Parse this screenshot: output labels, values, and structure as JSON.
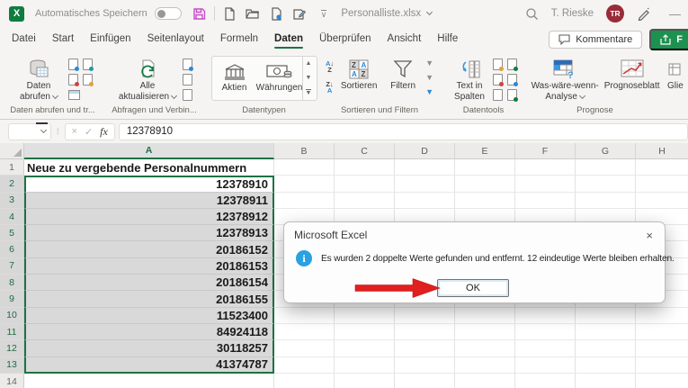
{
  "titlebar": {
    "app": "Excel",
    "logo_letter": "X",
    "autosave_label": "Automatisches Speichern",
    "filename": "Personalliste.xlsx",
    "user_name": "T. Rieske",
    "user_initials": "TR",
    "minimize_glyph": "—"
  },
  "menu": {
    "tabs": [
      "Datei",
      "Start",
      "Einfügen",
      "Seitenlayout",
      "Formeln",
      "Daten",
      "Überprüfen",
      "Ansicht",
      "Hilfe"
    ],
    "active_tab": "Daten",
    "comments_label": "Kommentare",
    "share_label": "F"
  },
  "ribbon": {
    "groups": {
      "get_data": {
        "label": "Daten abrufen und tr...",
        "button_line1": "Daten",
        "button_line2": "abrufen"
      },
      "queries": {
        "label": "Abfragen und Verbin...",
        "button_line1": "Alle",
        "button_line2": "aktualisieren"
      },
      "data_types": {
        "label": "Datentypen",
        "item1": "Aktien",
        "item2": "Währungen"
      },
      "sort_filter": {
        "label": "Sortieren und Filtern",
        "sort_label": "Sortieren",
        "filter_label": "Filtern",
        "az": "AZ↓",
        "za": "ZA↓"
      },
      "data_tools": {
        "label": "Datentools",
        "button_line1": "Text in",
        "button_line2": "Spalten"
      },
      "forecast": {
        "label": "Prognose",
        "whatif_line1": "Was-wäre-wenn-",
        "whatif_line2": "Analyse",
        "sheet_label": "Prognoseblatt"
      },
      "outline": {
        "label": "Glie"
      }
    }
  },
  "formula_bar": {
    "value": "12378910",
    "fx_label": "fx",
    "cancel_glyph": "×",
    "enter_glyph": "✓"
  },
  "sheet": {
    "columns": [
      "A",
      "B",
      "C",
      "D",
      "E",
      "F",
      "G",
      "H"
    ],
    "rows": [
      {
        "n": 1,
        "v": "Neue zu vergebende Personalnummern"
      },
      {
        "n": 2,
        "v": "12378910"
      },
      {
        "n": 3,
        "v": "12378911"
      },
      {
        "n": 4,
        "v": "12378912"
      },
      {
        "n": 5,
        "v": "12378913"
      },
      {
        "n": 6,
        "v": "20186152"
      },
      {
        "n": 7,
        "v": "20186153"
      },
      {
        "n": 8,
        "v": "20186154"
      },
      {
        "n": 9,
        "v": "20186155"
      },
      {
        "n": 10,
        "v": "11523400"
      },
      {
        "n": 11,
        "v": "84924118"
      },
      {
        "n": 12,
        "v": "30118257"
      },
      {
        "n": 13,
        "v": "41374787"
      },
      {
        "n": 14,
        "v": ""
      }
    ]
  },
  "dialog": {
    "title": "Microsoft Excel",
    "message": "Es wurden 2 doppelte Werte gefunden und entfernt. 12 eindeutige Werte bleiben erhalten.",
    "ok_label": "OK",
    "close_glyph": "×"
  },
  "colors": {
    "excel_green": "#107c41",
    "selection_green": "#1e7145",
    "info_blue": "#2aa1e0",
    "arrow_red": "#e01f1f",
    "avatar_maroon": "#9a2b38",
    "save_icon_magenta": "#c94ac9"
  }
}
